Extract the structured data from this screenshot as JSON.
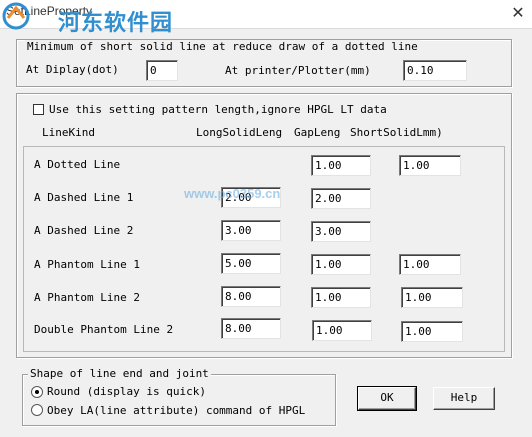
{
  "window": {
    "title": "SetLineProperty",
    "watermark_text": "河东软件园",
    "watermark_url": "www.pc0359.cn"
  },
  "short_line": {
    "heading": "Minimum of short solid line at reduce draw of a dotted line",
    "display_label": "At Diplay(dot)",
    "display_value": "0",
    "printer_label": "At printer/Plotter(mm)",
    "printer_value": "0.10"
  },
  "pattern": {
    "checkbox_label": "Use this setting pattern length,ignore HPGL LT data",
    "checkbox_checked": false,
    "headers": {
      "kind": "LineKind",
      "long": "LongSolidLeng",
      "gap": "GapLeng",
      "short": "ShortSolidLmm)"
    },
    "rows": [
      {
        "name": "A Dotted Line",
        "long": null,
        "gap": "1.00",
        "short": "1.00"
      },
      {
        "name": "A Dashed Line 1",
        "long": "2.00",
        "gap": "2.00",
        "short": null
      },
      {
        "name": "A Dashed Line 2",
        "long": "3.00",
        "gap": "3.00",
        "short": null
      },
      {
        "name": "A Phantom Line 1",
        "long": "5.00",
        "gap": "1.00",
        "short": "1.00"
      },
      {
        "name": "A Phantom Line 2",
        "long": "8.00",
        "gap": "1.00",
        "short": "1.00"
      },
      {
        "name": "Double Phantom Line 2",
        "long": "8.00",
        "gap": "1.00",
        "short": "1.00"
      }
    ]
  },
  "shape": {
    "group_title": "Shape of line end and joint",
    "options": [
      {
        "label": "Round (display is quick)",
        "selected": true
      },
      {
        "label": "Obey LA(line attribute) command of HPGL",
        "selected": false
      }
    ]
  },
  "buttons": {
    "ok": "OK",
    "help": "Help"
  }
}
